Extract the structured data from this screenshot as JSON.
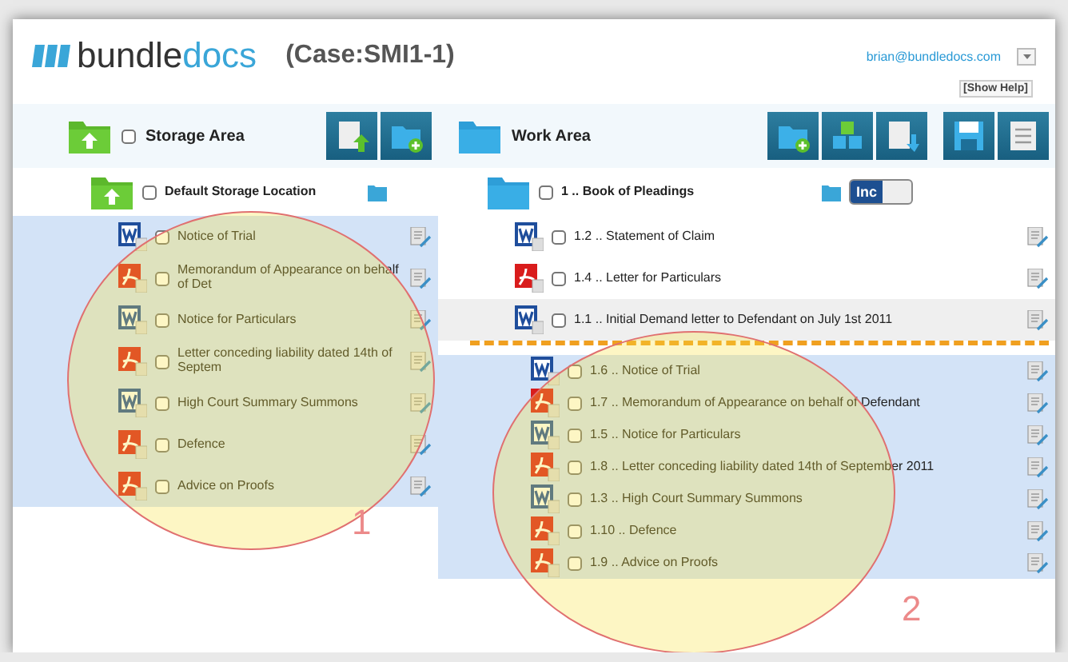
{
  "header": {
    "logo": {
      "part_1": "bundle",
      "part_2": "docs"
    },
    "case": "(Case:SMI1-1)",
    "user": "brian@bundledocs.com",
    "show_help": "[Show Help]"
  },
  "storage": {
    "title": "Storage Area",
    "checked": false,
    "location": {
      "label": "Default Storage Location",
      "checked": false
    },
    "documents": [
      {
        "kind": "word",
        "label": "Notice of Trial",
        "checked": false,
        "highlighted": true
      },
      {
        "kind": "pdf",
        "label": "Memorandum of Appearance on behalf of Det",
        "checked": false,
        "highlighted": true
      },
      {
        "kind": "word",
        "label": "Notice for Particulars",
        "checked": false,
        "highlighted": true
      },
      {
        "kind": "pdf",
        "label": "Letter conceding liability dated 14th of Septem",
        "checked": false,
        "highlighted": true
      },
      {
        "kind": "word",
        "label": "High Court Summary Summons",
        "checked": false,
        "highlighted": true
      },
      {
        "kind": "pdf",
        "label": "Defence",
        "checked": false,
        "highlighted": true
      },
      {
        "kind": "pdf",
        "label": "Advice on Proofs",
        "checked": false,
        "highlighted": true
      }
    ]
  },
  "work": {
    "title": "Work Area",
    "folder": {
      "label": "1 .. Book of Pleadings",
      "checked": false,
      "toggle": {
        "label": "Inc",
        "on": true
      }
    },
    "documents": [
      {
        "kind": "word",
        "label": "1.2 .. Statement of Claim",
        "checked": false,
        "highlighted": false
      },
      {
        "kind": "pdf",
        "label": "1.4 .. Letter for Particulars",
        "checked": false,
        "highlighted": false
      },
      {
        "kind": "word",
        "label": "1.1 .. Initial Demand letter to Defendant on July 1st 2011",
        "checked": false,
        "highlighted": false,
        "drop_target": true
      }
    ],
    "dragged_documents": [
      {
        "kind": "word",
        "label": "1.6 .. Notice of Trial",
        "checked": false,
        "highlighted": true
      },
      {
        "kind": "pdf",
        "label": "1.7 .. Memorandum of Appearance on behalf of Defendant",
        "checked": false,
        "highlighted": true
      },
      {
        "kind": "word",
        "label": "1.5 .. Notice for Particulars",
        "checked": false,
        "highlighted": true
      },
      {
        "kind": "pdf",
        "label": "1.8 .. Letter conceding liability dated 14th of September 2011",
        "checked": false,
        "highlighted": true
      },
      {
        "kind": "word",
        "label": "1.3 .. High Court Summary Summons",
        "checked": false,
        "highlighted": true
      },
      {
        "kind": "pdf",
        "label": "1.10 .. Defence",
        "checked": false,
        "highlighted": true
      },
      {
        "kind": "pdf",
        "label": "1.9 .. Advice on Proofs",
        "checked": false,
        "highlighted": true
      }
    ]
  },
  "annotations": [
    {
      "label": "1"
    },
    {
      "label": "2"
    }
  ]
}
